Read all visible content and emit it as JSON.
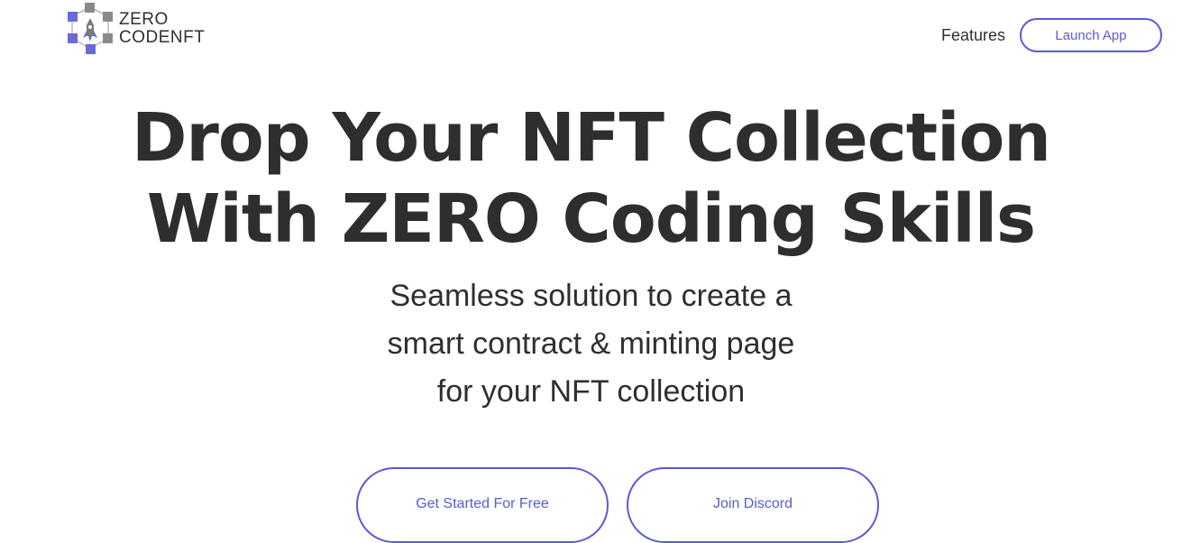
{
  "brand": {
    "line1": "ZERO",
    "line2": "CODENFT",
    "accent_color": "#5b5bd6",
    "icon": "rocket-cubes-logo-icon"
  },
  "nav": {
    "features_label": "Features",
    "launch_label": "Launch App"
  },
  "hero": {
    "title_line1": "Drop Your NFT Collection",
    "title_line2": "With ZERO Coding Skills",
    "subtitle_line1": "Seamless solution to create a",
    "subtitle_line2": "smart contract & minting page",
    "subtitle_line3": "for your NFT collection"
  },
  "cta": {
    "primary_label": "Get Started For Free",
    "secondary_label": "Join Discord"
  }
}
